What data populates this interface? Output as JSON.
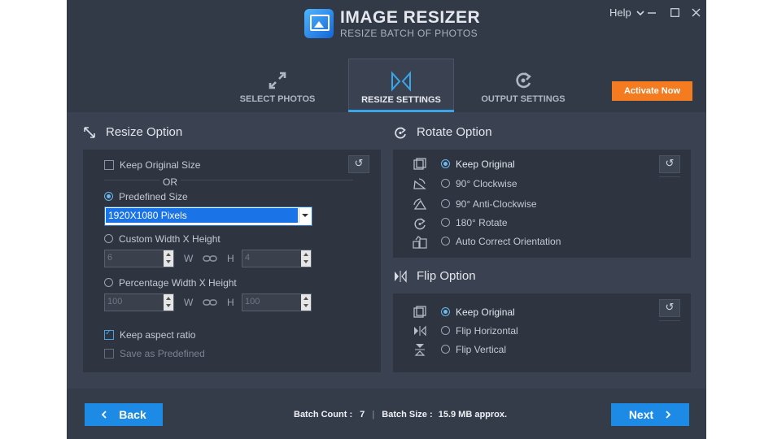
{
  "app": {
    "title": "IMAGE RESIZER",
    "subtitle": "RESIZE BATCH OF PHOTOS",
    "help_label": "Help",
    "activate_label": "Activate Now"
  },
  "tabs": [
    {
      "label": "SELECT PHOTOS",
      "icon": "expand-arrows-icon"
    },
    {
      "label": "RESIZE SETTINGS",
      "icon": "resize-bowtie-icon",
      "active": true
    },
    {
      "label": "OUTPUT SETTINGS",
      "icon": "output-cycle-icon"
    }
  ],
  "resize": {
    "title": "Resize Option",
    "keep_original": "Keep Original Size",
    "or_label": "OR",
    "predefined": "Predefined Size",
    "predefined_value": "1920X1080 Pixels",
    "custom": "Custom Width X Height",
    "custom_w": "6",
    "custom_h": "4",
    "w_label": "W",
    "h_label": "H",
    "percentage": "Percentage Width X Height",
    "pct_w": "100",
    "pct_h": "100",
    "keep_aspect": "Keep aspect ratio",
    "save_predefined": "Save as Predefined"
  },
  "rotate": {
    "title": "Rotate Option",
    "options": [
      "Keep Original",
      "90° Clockwise",
      "90° Anti-Clockwise",
      "180° Rotate",
      "Auto Correct Orientation"
    ],
    "selected_index": 0
  },
  "flip": {
    "title": "Flip Option",
    "options": [
      "Keep Original",
      "Flip Horizontal",
      "Flip Vertical"
    ],
    "selected_index": 0
  },
  "footer": {
    "back_label": "Back",
    "next_label": "Next",
    "batch_count_label": "Batch Count :",
    "batch_count_value": "7",
    "batch_size_label": "Batch Size :",
    "batch_size_value": "15.9 MB approx."
  },
  "colors": {
    "accent": "#1d8ae6",
    "activate": "#f47b20",
    "tab_underline": "#39a6ea",
    "background": "#3a4150",
    "panel": "#2e3440"
  }
}
